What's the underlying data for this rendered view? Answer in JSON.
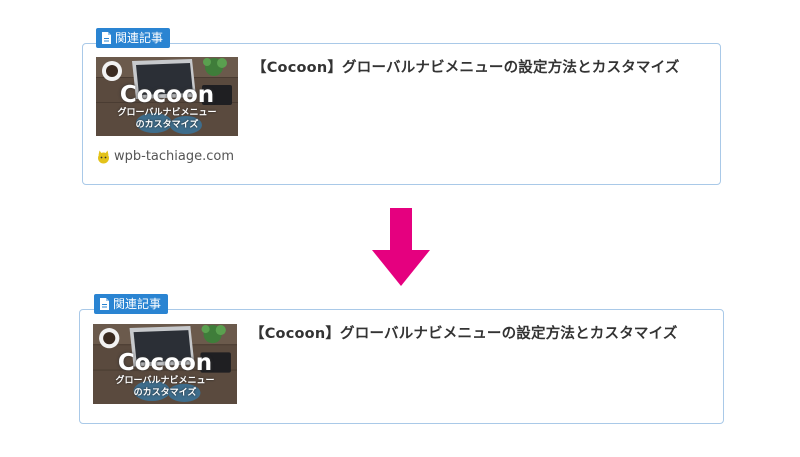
{
  "top_card": {
    "label": "関連記事",
    "title": "【Cocoon】グローバルナビメニューの設定方法とカスタマイズ",
    "site": "wpb-tachiage.com",
    "thumb_title": "Cocoon",
    "thumb_subtitle_1": "グローバルナビメニュー",
    "thumb_subtitle_2": "のカスタマイズ"
  },
  "bottom_card": {
    "label": "関連記事",
    "title": "【Cocoon】グローバルナビメニューの設定方法とカスタマイズ",
    "thumb_title": "Cocoon",
    "thumb_subtitle_1": "グローバルナビメニュー",
    "thumb_subtitle_2": "のカスタマイズ"
  },
  "colors": {
    "label_bg": "#2a84d2",
    "card_border": "#a9c9e8",
    "arrow": "#e5007f"
  },
  "icons": [
    "document-icon",
    "favicon-icon",
    "down-arrow-icon"
  ]
}
